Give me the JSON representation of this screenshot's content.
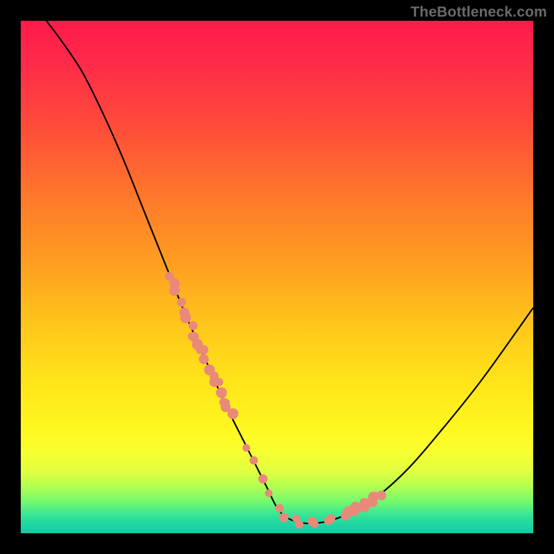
{
  "watermark": "TheBottleneck.com",
  "chart_data": {
    "type": "line",
    "title": "",
    "xlabel": "",
    "ylabel": "",
    "xlim": [
      0,
      100
    ],
    "ylim": [
      0,
      100
    ],
    "grid": false,
    "series": [
      {
        "name": "bottleneck-curve",
        "x": [
          5,
          8,
          12,
          16,
          20,
          24,
          28,
          32,
          36,
          40,
          44,
          48,
          50,
          52,
          55,
          58,
          62,
          68,
          75,
          82,
          90,
          100
        ],
        "y": [
          100,
          96,
          90,
          82,
          73,
          63,
          53,
          43,
          34,
          25,
          17,
          9,
          5,
          3,
          2,
          2,
          3,
          6,
          12,
          20,
          30,
          44
        ]
      }
    ],
    "annotations": {
      "left_dots_range_x": [
        29,
        41
      ],
      "right_dots_range_x": [
        63,
        70
      ],
      "bottom_dots_range_x": [
        44,
        61
      ]
    },
    "gradient_stops": [
      {
        "pos": 0,
        "color": "#ff1a4a"
      },
      {
        "pos": 50,
        "color": "#ffc81a"
      },
      {
        "pos": 85,
        "color": "#f8ff30"
      },
      {
        "pos": 100,
        "color": "#18c8a8"
      }
    ]
  }
}
